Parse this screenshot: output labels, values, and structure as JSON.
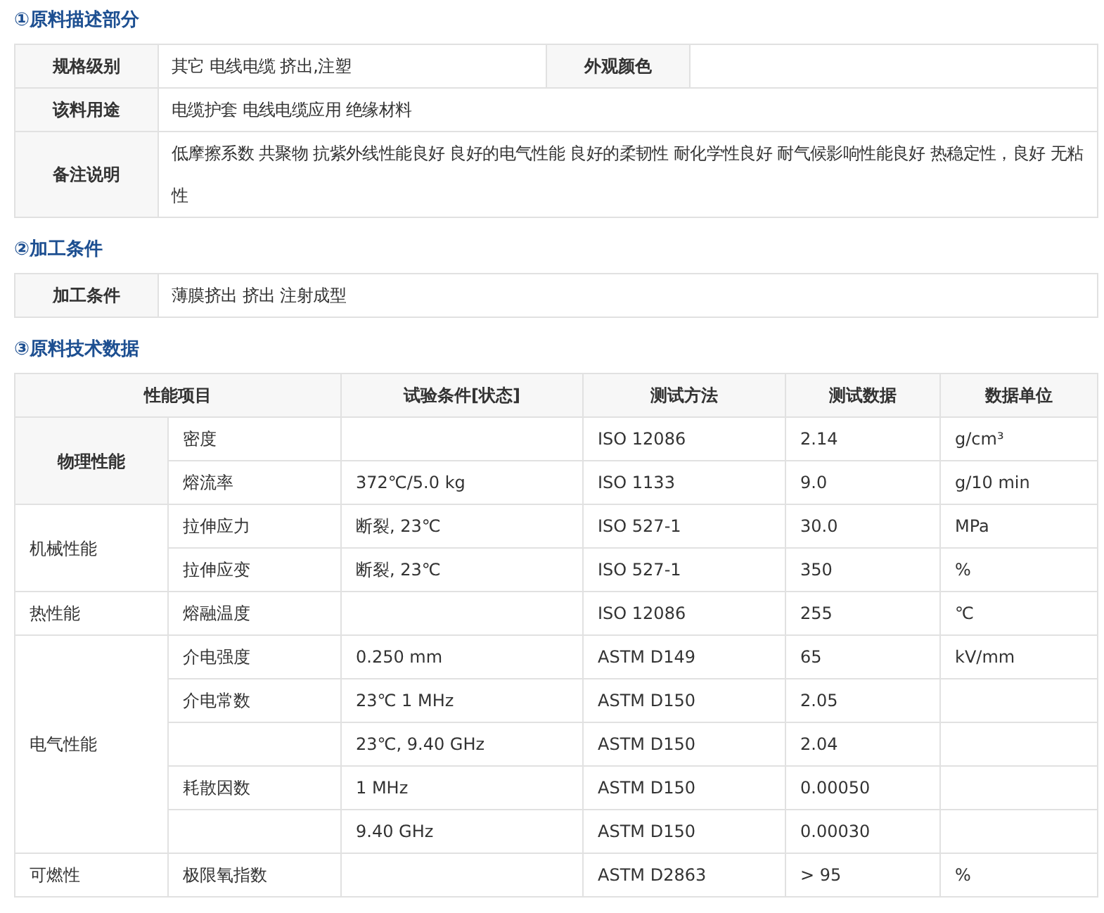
{
  "sections": [
    {
      "title": "①原料描述部分",
      "spec": {
        "label": "规格级别",
        "value": "其它 电线电缆 挤出,注塑",
        "label_2": "外观颜色"
      },
      "rows": [
        {
          "label": "该料用途",
          "value": "电缆护套 电线电缆应用 绝缘材料"
        },
        {
          "label": "备注说明",
          "value": "低摩擦系数 共聚物 抗紫外线性能良好 良好的电气性能 良好的柔韧性 耐化学性良好 耐气候影响性能良好 热稳定性，良好 无粘性"
        }
      ]
    },
    {
      "title": "②加工条件",
      "rows": [
        {
          "label": "加工条件",
          "value": "薄膜挤出 挤出 注射成型"
        }
      ]
    },
    {
      "title": "③原料技术数据",
      "columns": [
        "性能项目",
        "试验条件[状态]",
        "测试方法",
        "测试数据",
        "数据单位"
      ],
      "groups": [
        {
          "label": "物理性能",
          "emphasized": true,
          "rows": [
            {
              "item": "密度",
              "method": "ISO 12086",
              "value": "2.14",
              "unit": "g/cm³"
            },
            {
              "item": "熔流率",
              "condition": "372℃/5.0 kg",
              "method": "ISO 1133",
              "value": "9.0",
              "unit": "g/10 min"
            }
          ]
        },
        {
          "label": "机械性能",
          "emphasized": false,
          "rows": [
            {
              "item": "拉伸应力",
              "condition": "断裂, 23℃",
              "method": "ISO 527-1",
              "value": "30.0",
              "unit": "MPa"
            },
            {
              "item": "拉伸应变",
              "condition": "断裂, 23℃",
              "method": "ISO 527-1",
              "value": "350",
              "unit": "%"
            }
          ]
        },
        {
          "label": "热性能",
          "emphasized": false,
          "rows": [
            {
              "item": "熔融温度",
              "method": "ISO 12086",
              "value": "255",
              "unit": "℃"
            }
          ]
        },
        {
          "label": "电气性能",
          "emphasized": false,
          "rows": [
            {
              "item": "介电强度",
              "condition": "0.250 mm",
              "method": "ASTM D149",
              "value": "65",
              "unit": "kV/mm"
            },
            {
              "item": "介电常数",
              "condition": "23℃ 1 MHz",
              "method": "ASTM D150",
              "value": "2.05"
            },
            {
              "condition": "23℃, 9.40 GHz",
              "method": "ASTM D150",
              "value": "2.04"
            },
            {
              "item": "耗散因数",
              "condition": "1 MHz",
              "method": "ASTM D150",
              "value": "0.00050"
            },
            {
              "condition": "9.40 GHz",
              "method": "ASTM D150",
              "value": "0.00030"
            }
          ]
        },
        {
          "label": "可燃性",
          "emphasized": false,
          "rows": [
            {
              "item": "极限氧指数",
              "method": "ASTM D2863",
              "value": "> 95",
              "unit": "%"
            }
          ]
        }
      ]
    }
  ]
}
